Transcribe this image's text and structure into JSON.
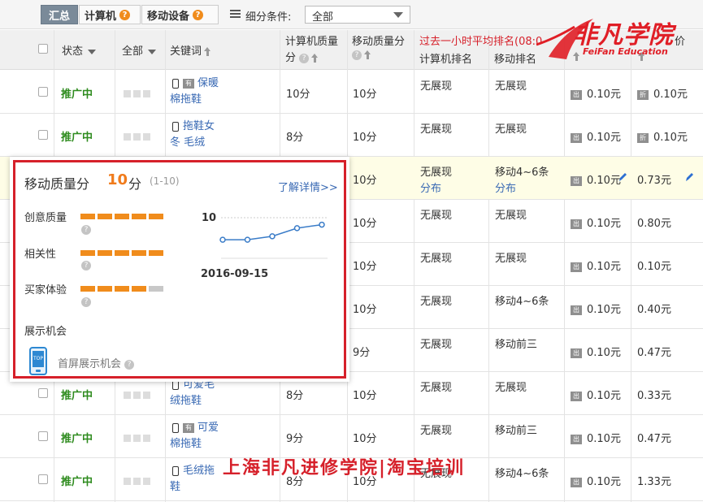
{
  "tabs": [
    {
      "label": "汇总",
      "active": true
    },
    {
      "label": "计算机",
      "help": "?"
    },
    {
      "label": "移动设备",
      "help": "?"
    }
  ],
  "filter": {
    "label": "细分条件:",
    "selected": "全部"
  },
  "headers": {
    "status": "状态",
    "all": "全部",
    "keyword": "关键词",
    "pc_quality_l1": "计算机质量",
    "pc_quality_l2": "分",
    "mobile_quality_l1": "移动质量分",
    "rank_group": "过去一小时平均排名(08:0",
    "pc_rank": "计算机排名",
    "mobile_rank": "移动排名",
    "col8_tail": "价",
    "help": "?"
  },
  "rows": [
    {
      "status": "推广中",
      "kw1": "保暖",
      "kw2": "棉拖鞋",
      "tag": true,
      "pcq": "10分",
      "mq": "10分",
      "pcr": "无展现",
      "mr": "无展现",
      "b1": "0.10元",
      "b2": "0.10元",
      "b2tag": "折"
    },
    {
      "status": "推广中",
      "kw1": "拖鞋女",
      "kw2": "冬 毛绒",
      "tag": false,
      "pcq": "8分",
      "mq": "10分",
      "pcr": "无展现",
      "mr": "无展现",
      "b1": "0.10元",
      "b2": "0.10元",
      "b2tag": "折"
    },
    {
      "status": "",
      "kw1": "",
      "kw2": "",
      "tag": false,
      "pcq": "",
      "mq": "10分",
      "pcr": "无展现",
      "pcr2": "分布",
      "mr": "移动4~6条",
      "mr2": "分布",
      "b1": "0.10元",
      "b2": "0.73元",
      "b2tag": ""
    },
    {
      "status": "",
      "kw1": "",
      "kw2": "",
      "tag": false,
      "pcq": "",
      "mq": "10分",
      "pcr": "无展现",
      "mr": "无展现",
      "b1": "0.10元",
      "b2": "0.80元",
      "b2tag": ""
    },
    {
      "status": "",
      "kw1": "",
      "kw2": "",
      "tag": false,
      "pcq": "",
      "mq": "10分",
      "pcr": "无展现",
      "mr": "无展现",
      "b1": "0.10元",
      "b2": "0.10元",
      "b2tag": ""
    },
    {
      "status": "",
      "kw1": "",
      "kw2": "",
      "tag": false,
      "pcq": "",
      "mq": "10分",
      "pcr": "无展现",
      "mr": "移动4~6条",
      "b1": "0.10元",
      "b2": "0.40元",
      "b2tag": ""
    },
    {
      "status": "",
      "kw1": "",
      "kw2": "",
      "tag": false,
      "pcq": "",
      "mq": "9分",
      "pcr": "无展现",
      "mr": "移动前三",
      "b1": "0.10元",
      "b2": "0.47元",
      "b2tag": ""
    },
    {
      "status": "推广中",
      "kw1": "可爱毛",
      "kw2": "绒拖鞋",
      "tag": false,
      "pcq": "8分",
      "mq": "10分",
      "pcr": "无展现",
      "mr": "无展现",
      "b1": "0.10元",
      "b2": "0.33元",
      "b2tag": ""
    },
    {
      "status": "推广中",
      "kw1": "可爱",
      "kw2": "棉拖鞋",
      "tag": true,
      "pcq": "9分",
      "mq": "10分",
      "pcr": "无展现",
      "mr": "移动前三",
      "b1": "0.10元",
      "b2": "0.47元",
      "b2tag": ""
    },
    {
      "status": "推广中",
      "kw1": "毛绒拖",
      "kw2": "鞋",
      "tag": false,
      "pcq": "8分",
      "mq": "10分",
      "pcr": "无展现",
      "mr": "移动4~6条",
      "b1": "0.10元",
      "b2": "1.33元",
      "b2tag": ""
    }
  ],
  "popup": {
    "title": "移动质量分",
    "score": "10",
    "unit": "分",
    "range": "(1-10)",
    "link": "了解详情>>",
    "metrics": [
      {
        "label": "创意质量",
        "level": 5,
        "max": 5
      },
      {
        "label": "相关性",
        "level": 5,
        "max": 5
      },
      {
        "label": "买家体验",
        "level": 4,
        "max": 5
      }
    ],
    "chart_data": {
      "type": "line",
      "y_label": "10",
      "x_label": "2016-09-15",
      "values": [
        8.6,
        8.6,
        8.9,
        9.6,
        9.9
      ],
      "ylim": [
        7,
        10.5
      ]
    },
    "exposure_label": "展示机会",
    "screen_label": "首屏展示机会",
    "phone_icon_text": "TOP"
  },
  "brand": {
    "name": "非凡学院",
    "sub": "FeiFan Education"
  },
  "watermark": "上海非凡进修学院|淘宝培训",
  "colors": {
    "accent": "#f07b1c",
    "status": "#2e8b1e",
    "link": "#3a6ab4",
    "brand": "#e01e26"
  }
}
